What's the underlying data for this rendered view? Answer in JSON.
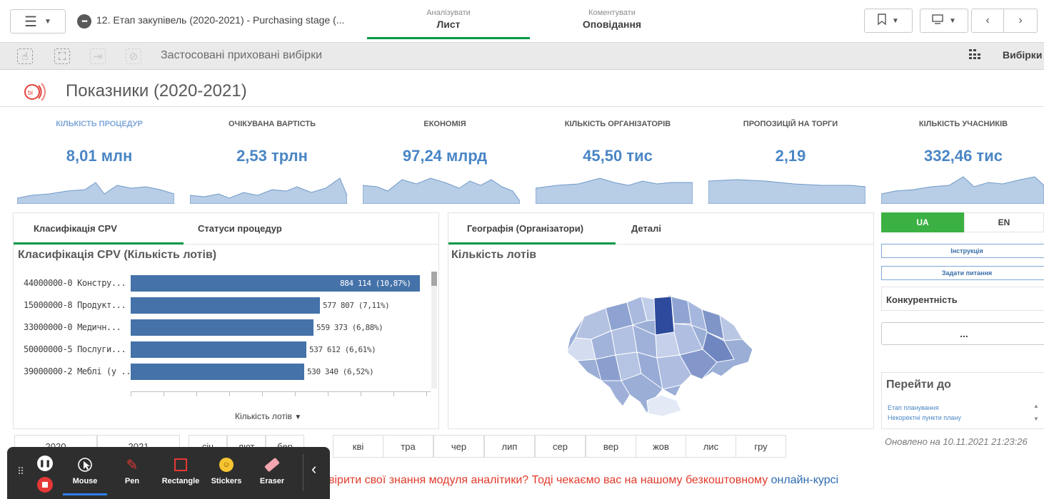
{
  "topbar": {
    "app_title": "12. Етап закупівель (2020-2021) - Purchasing stage (...",
    "modes": [
      {
        "sub": "Аналізувати",
        "main": "Лист"
      },
      {
        "sub": "Коментувати",
        "main": "Оповідання"
      }
    ]
  },
  "toolbar": {
    "selection_text": "Застосовані приховані вибірки",
    "selections_label": "Вибірки"
  },
  "sheet": {
    "title": "Показники (2020-2021)"
  },
  "kpis": [
    {
      "label": "Кількість процедур",
      "value": "8,01 млн"
    },
    {
      "label": "Очікувана вартість",
      "value": "2,53 трлн"
    },
    {
      "label": "Економія",
      "value": "97,24 млрд"
    },
    {
      "label": "Кількість організаторів",
      "value": "45,50 тис"
    },
    {
      "label": "Пропозицій на торги",
      "value": "2,19"
    },
    {
      "label": "Кількість учасників",
      "value": "332,46 тис"
    }
  ],
  "cpv_panel": {
    "tabs": [
      "Класифікація CPV",
      "Статуси процедур"
    ],
    "title": "Класифікація CPV (Кількість лотів)",
    "x_label": "Кількість лотів",
    "chart_data": {
      "type": "bar",
      "orientation": "horizontal",
      "title": "Класифікація CPV (Кількість лотів)",
      "xlabel": "Кількість лотів",
      "categories": [
        "44000000-0 Констру...",
        "15000000-8 Продукт...",
        "33000000-0 Медичн...",
        "50000000-5 Послуги...",
        "39000000-2 Меблі (у ..."
      ],
      "values": [
        884114,
        577807,
        559373,
        537612,
        530340
      ],
      "data_labels": [
        "884 114 (10,87%)",
        "577 807 (7,11%)",
        "559 373 (6,88%)",
        "537 612 (6,61%)",
        "530 340 (6,52%)"
      ]
    }
  },
  "geo_panel": {
    "tabs": [
      "Географія (Організатори)",
      "Деталі"
    ],
    "title": "Кількість лотів"
  },
  "side": {
    "lang_ua": "UA",
    "lang_en": "EN",
    "btn_instruction": "Інструкція",
    "btn_question": "Задати питання",
    "competition": "Конкурентність",
    "more": "...",
    "goto_title": "Перейти до",
    "goto_links": [
      "Етап планування",
      "Некоректні пункти плану"
    ],
    "updated": "Оновлено на 10.11.2021 21:23:26"
  },
  "years": [
    "2020",
    "2021"
  ],
  "months": [
    "січ",
    "лют",
    "бер",
    "кві",
    "тра",
    "чер",
    "лип",
    "сер",
    "вер",
    "жов",
    "лис",
    "гру"
  ],
  "banner": {
    "text": "вірити свої знання модуля аналітики? Тоді чекаємо вас на нашому безкоштовному ",
    "link": "онлайн-курсі"
  },
  "annotation_toolbar": {
    "tools": [
      "Mouse",
      "Pen",
      "Rectangle",
      "Stickers",
      "Eraser"
    ]
  },
  "colors": {
    "accent": "#009845",
    "bar": "#4472a9",
    "kpi_value": "#4a86c5",
    "banner": "#e03a2b"
  }
}
